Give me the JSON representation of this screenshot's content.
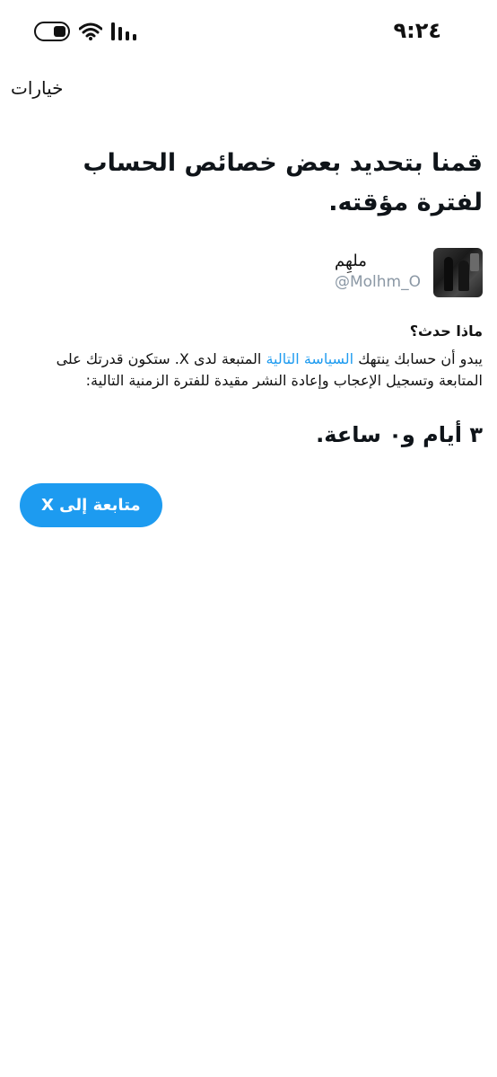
{
  "status_bar": {
    "time": "٩:٢٤",
    "icons": [
      "toggle-icon",
      "wifi-icon",
      "signal-icon"
    ]
  },
  "header": {
    "options_label": "خيارات"
  },
  "main": {
    "title": "قمنا بتحديد بعض خصائص الحساب لفترة مؤقته.",
    "profile": {
      "name": "ملهِم",
      "handle": "@Molhm_O"
    },
    "what_happened_heading": "ماذا حدث؟",
    "explanation_before": "يبدو أن حسابك ينتهك ",
    "policy_link": "السياسة التالية",
    "explanation_after": " المتبعة لدى X. ستكون قدرتك على المتابعة وتسجيل الإعجاب وإعادة النشر مقيدة للفترة الزمنية التالية:",
    "duration": "٣ أيام و٠ ساعة.",
    "continue_button": "متابعة إلى X"
  },
  "colors": {
    "accent": "#1d9bf0",
    "handle_gray": "#8b98a5",
    "text": "#0f1419"
  }
}
